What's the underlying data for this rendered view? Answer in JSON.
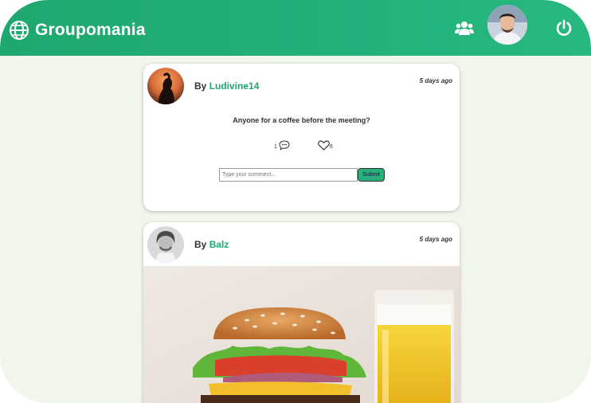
{
  "header": {
    "brand": "Groupomania",
    "colors": {
      "primary": "#1fa86e",
      "background": "#f1f6ec"
    },
    "icons": {
      "logo": "globe-icon",
      "users": "users-icon",
      "power": "power-icon"
    }
  },
  "posts": [
    {
      "by_label": "By",
      "author": "Ludivine14",
      "time": "5 days ago",
      "text": "Anyone for a coffee before the meeting?",
      "comment_count": "1",
      "like_count": "6",
      "comment_placeholder": "Type your comment...",
      "submit_label": "Submit"
    },
    {
      "by_label": "By",
      "author": "Balz",
      "time": "5 days ago"
    }
  ]
}
